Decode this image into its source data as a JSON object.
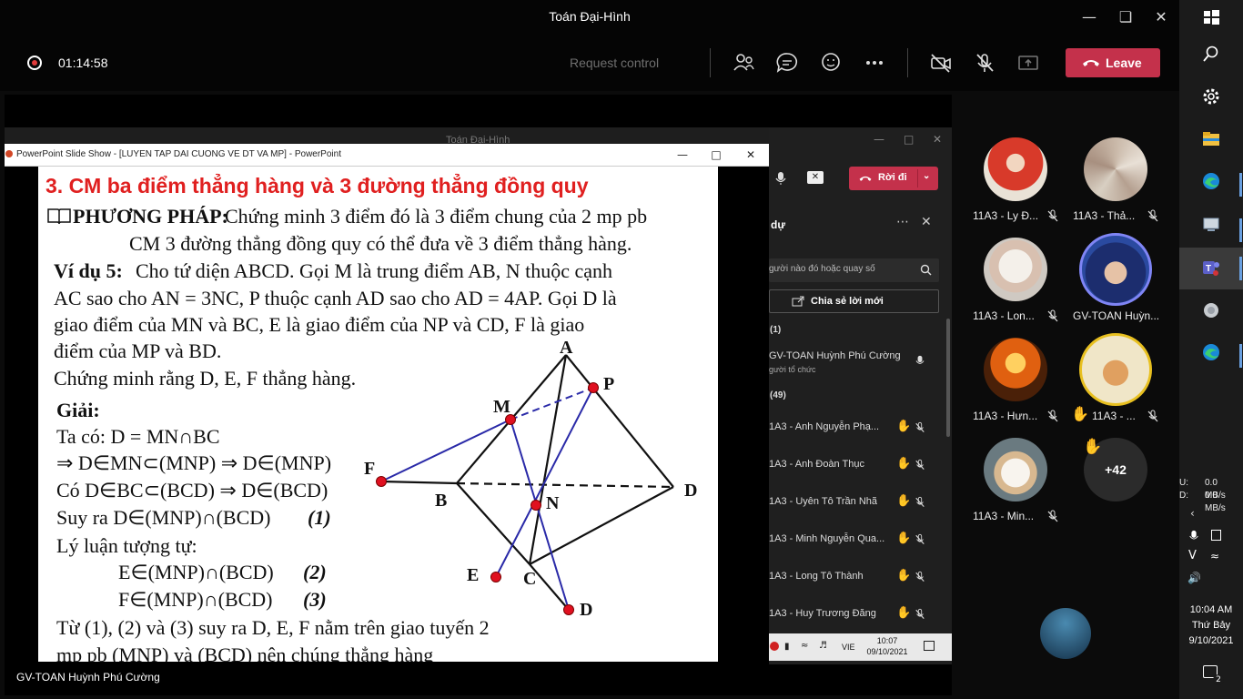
{
  "window": {
    "title": "Toán Đại-Hình"
  },
  "meeting": {
    "timer": "01:14:58",
    "request_control": "Request control",
    "leave_label": "Leave"
  },
  "inner_window": {
    "title": "Toán Đại-Hình"
  },
  "powerpoint": {
    "title": "PowerPoint Slide Show - [LUYEN TAP DAI CUONG VE DT VA MP] - PowerPoint"
  },
  "slide": {
    "heading": "3. CM ba điểm thẳng hàng và 3 đường thẳng đồng quy",
    "method_label": "PHƯƠNG PHÁP:",
    "method_text": "Chứng minh 3 điểm đó là 3 điểm chung của 2 mp pb",
    "method_line2": "CM 3 đường thẳng đồng quy có thể đưa về 3 điểm thẳng hàng.",
    "example_label": "Ví dụ 5:",
    "example_lines": [
      "Cho tứ diện ABCD. Gọi M là trung điểm AB, N thuộc cạnh",
      "AC sao cho AN = 3NC, P thuộc cạnh AD sao cho AD = 4AP. Gọi D là",
      "giao điểm của MN và BC, E là giao điểm của NP và CD, F là giao",
      "điểm của MP và BD.",
      "Chứng minh rằng D, E, F thẳng hàng."
    ],
    "solution_label": "Giải:",
    "solution_lines": [
      "Ta có: D = MN∩BC",
      "⇒ D∈MN⊂(MNP) ⇒ D∈(MNP)",
      "Có D∈BC⊂(BCD) ⇒ D∈(BCD)",
      "Suy ra D∈(MNP)∩(BCD)",
      "Lý luận tượng tự:",
      "E∈(MNP)∩(BCD)",
      "F∈(MNP)∩(BCD)",
      "Từ (1), (2) và (3) suy ra D, E, F nằm trên giao tuyến 2",
      "mp pb (MNP) và (BCD) nên chúng thẳng hàng"
    ],
    "solution_tags": [
      "(1)",
      "(2)",
      "(3)"
    ],
    "figure_labels": {
      "A": "A",
      "B": "B",
      "C": "C",
      "D": "D",
      "D2": "D",
      "M": "M",
      "N": "N",
      "P": "P",
      "E": "E",
      "F": "F"
    }
  },
  "inner_teams": {
    "leave_label": "Rời đi",
    "pane_title": "dự",
    "search_placeholder": "gười nào đó hoặc quay số",
    "share_invite": "Chia sẻ lời mới",
    "section_organizers": "(1)",
    "organizer_name": "GV-TOAN Huỳnh Phú Cường",
    "organizer_role": "gười tổ chức",
    "section_attendees": "(49)",
    "attendees": [
      "1A3 - Anh Nguyễn Phạ...",
      "1A3 - Anh Đoàn Thục",
      "1A3 - Uyên Tô Trần Nhã",
      "1A3 - Minh Nguyễn Qua...",
      "1A3 - Long Tô Thành",
      "1A3 - Huy Trương Đăng"
    ],
    "taskbar_lang": "VIE",
    "taskbar_time": "10:07",
    "taskbar_date": "09/10/2021"
  },
  "presenter_name": "GV-TOAN Huỳnh Phú Cường",
  "gallery": {
    "participants": [
      "11A3 - Ly Đ...",
      "11A3 - Thả...",
      "11A3 - Lon...",
      "GV-TOAN Huỳn...",
      "11A3 - Hưn...",
      "11A3 - ...",
      "11A3 - Min..."
    ],
    "overflow_count": "+42"
  },
  "system": {
    "net_up_label": "U:",
    "net_up": "0.0 MB/s",
    "net_down_label": "D:",
    "net_down": "0.0 MB/s",
    "time": "10:04 AM",
    "day": "Thứ Bảy",
    "date": "9/10/2021",
    "notifications": "2"
  },
  "colors": {
    "leave": "#c4314b",
    "heading_red": "#e02020",
    "figure_blue": "#2a2aa8",
    "point_red": "#e01020",
    "hand": "#e8b020"
  }
}
